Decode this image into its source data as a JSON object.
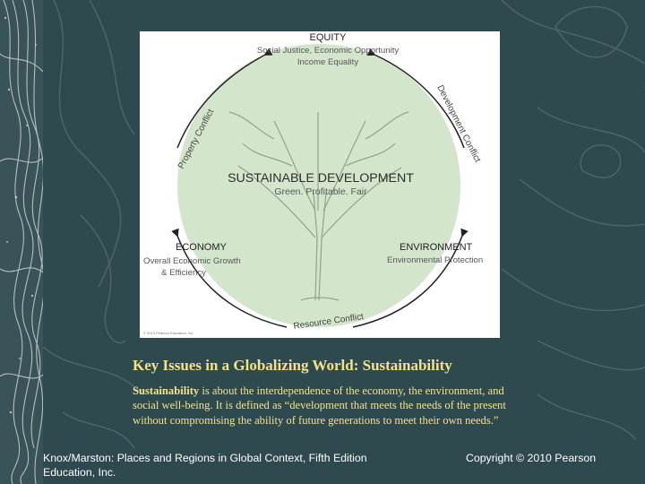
{
  "slide": {
    "title": "Key Issues in a Globalizing World: Sustainability",
    "body_term": "Sustainability",
    "body_rest": " is about the interdependence of the economy, the environment, and social well-being. It is defined as “development that meets the needs of the present without compromising the ability of future generations to meet their own needs.”",
    "footer_left": " Knox/Marston: Places and Regions in Global Context, Fifth Edition Education, Inc.",
    "footer_right": "Copyright © 2010 Pearson"
  },
  "diagram": {
    "center_title": "SUSTAINABLE DEVELOPMENT",
    "center_subtitle": "Green.  Profitable.  Fair",
    "equity": {
      "title": "EQUITY",
      "line1": "Social Justice, Economic Opportunity",
      "line2": "Income Equality"
    },
    "economy": {
      "title": "ECONOMY",
      "line1": "Overall Economic Growth",
      "line2": "& Efficiency"
    },
    "environment": {
      "title": "ENVIRONMENT",
      "line1": "Environmental Protection"
    },
    "conflicts": {
      "property": "Property Conflict",
      "development": "Development Conflict",
      "resource": "Resource Conflict"
    },
    "credit": "© 2013 Pearson Education, Inc."
  },
  "colors": {
    "background": "#2f4a4f",
    "circle_fill": "#d3e6cc",
    "title_text": "#f3e28a",
    "footer_text": "#ffffff"
  }
}
